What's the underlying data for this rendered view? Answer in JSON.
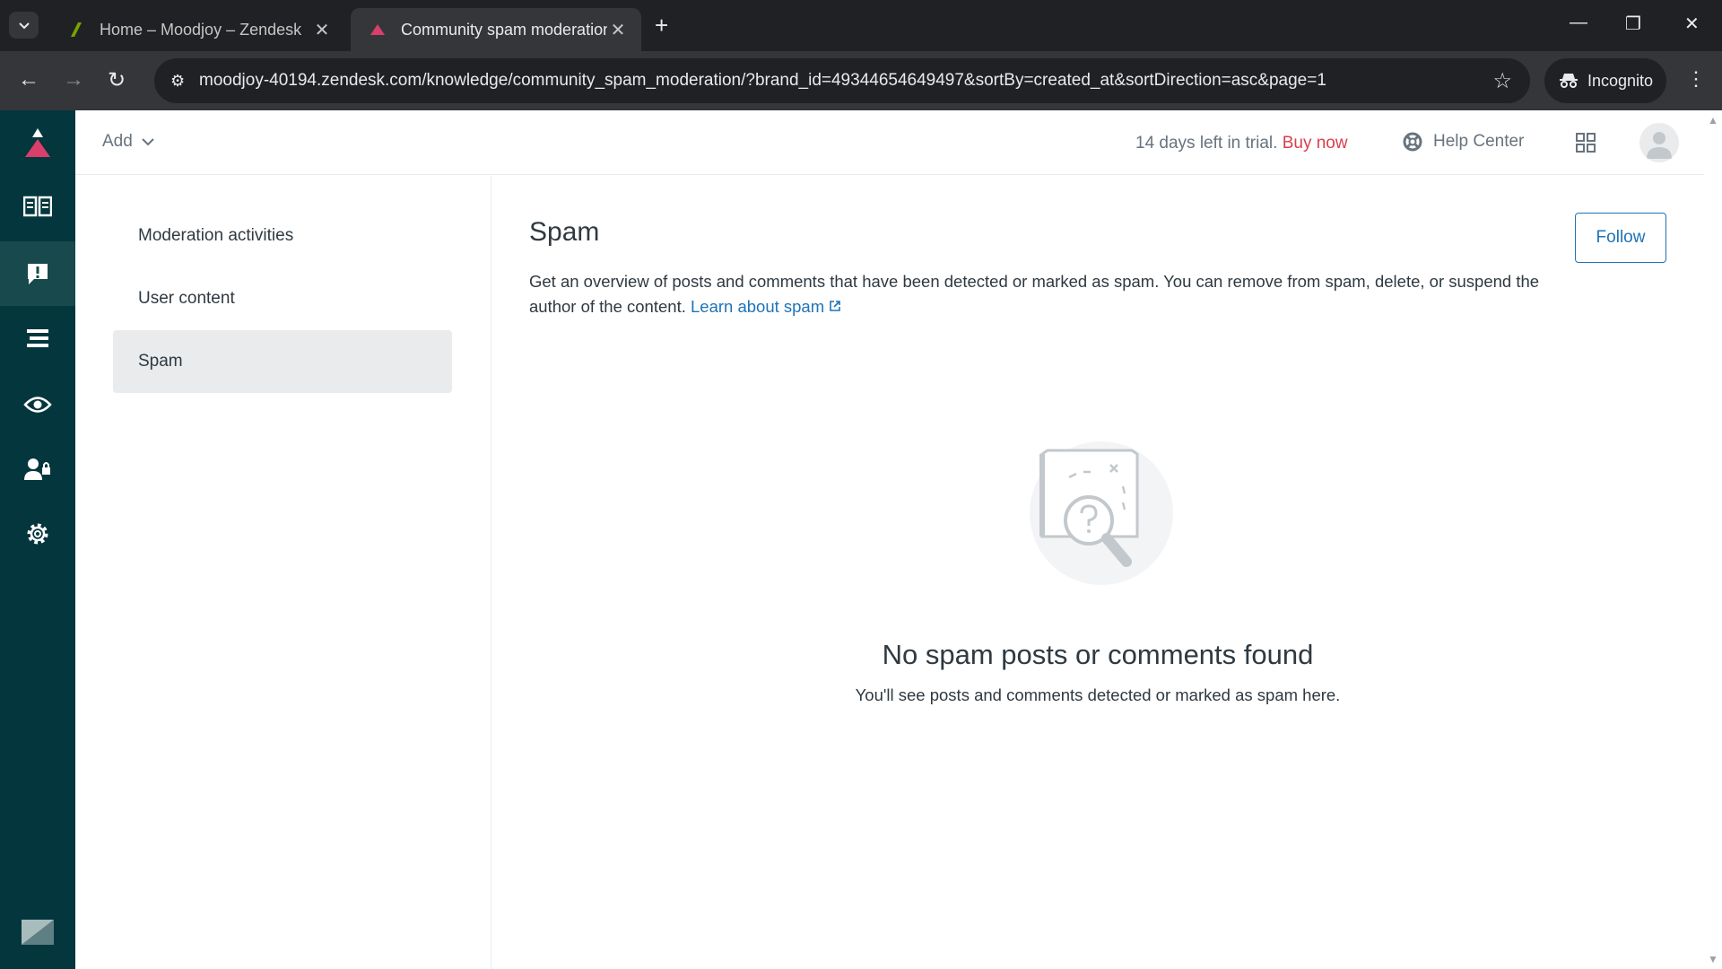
{
  "browser": {
    "tabs": [
      {
        "title": "Home – Moodjoy – Zendesk",
        "active": false
      },
      {
        "title": "Community spam moderation",
        "active": true
      }
    ],
    "url": "moodjoy-40194.zendesk.com/knowledge/community_spam_moderation/?brand_id=49344654649497&sortBy=created_at&sortDirection=asc&page=1",
    "incognito_label": "Incognito"
  },
  "header": {
    "add_label": "Add",
    "trial_text": "14 days left in trial.",
    "buy_now": "Buy now",
    "help_center": "Help Center"
  },
  "sidenav": {
    "items": [
      {
        "label": "Moderation activities"
      },
      {
        "label": "User content"
      },
      {
        "label": "Spam",
        "active": true
      }
    ]
  },
  "main": {
    "title": "Spam",
    "follow_label": "Follow",
    "description": "Get an overview of posts and comments that have been detected or marked as spam. You can remove from spam, delete, or suspend the author of the content.",
    "learn_link": "Learn about spam",
    "empty_title": "No spam posts or comments found",
    "empty_subtitle": "You'll see posts and comments detected or marked as spam here."
  },
  "colors": {
    "rail": "#03363d",
    "accent_link": "#1f73b7",
    "buy_now": "#d93f4c"
  }
}
